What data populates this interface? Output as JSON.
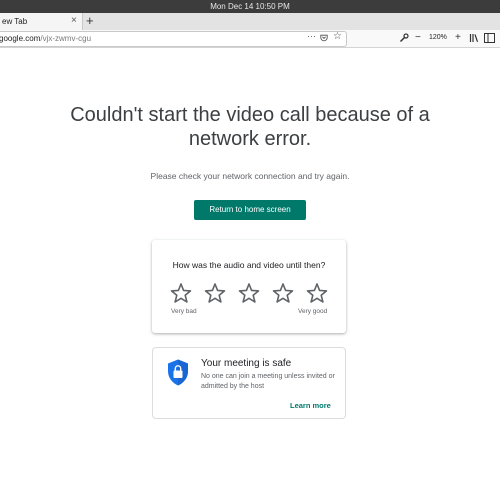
{
  "os": {
    "clock": "Mon Dec 14  10:50 PM"
  },
  "browser": {
    "tab_title": "ew Tab",
    "tab_close_icon": "×",
    "new_tab_icon": "+",
    "url_host": "google.com",
    "url_path": "/vjx-zwmv-cgu",
    "url_more_icon": "···",
    "zoom_level": "120%",
    "icons": [
      "more-icon",
      "pocket-icon",
      "bookmark-star-icon",
      "wrench-icon",
      "zoom-out-icon",
      "zoom-in-icon",
      "library-icon",
      "sidebar-icon"
    ]
  },
  "main": {
    "headline": "Couldn't start the video call because of a network error.",
    "subtext": "Please check your network connection and try again.",
    "home_button": "Return to home screen"
  },
  "rating": {
    "question": "How was the audio and video until then?",
    "stars": 5,
    "low_label": "Very bad",
    "high_label": "Very good"
  },
  "safety": {
    "title": "Your meeting is safe",
    "description": "No one can join a meeting unless invited or admitted by the host",
    "learn_more": "Learn more"
  },
  "colors": {
    "accent": "#00796b",
    "shield": "#1a73e8",
    "text_primary": "#3c4043",
    "text_secondary": "#5f6368"
  }
}
